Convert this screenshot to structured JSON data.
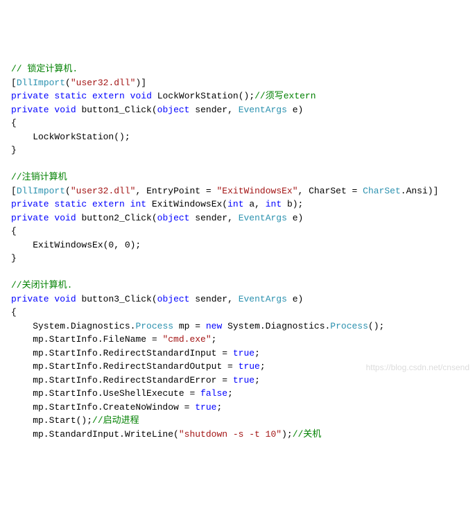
{
  "code": {
    "lines": [
      [
        {
          "cls": "c-comment",
          "t": "// 锁定计算机."
        }
      ],
      [
        {
          "cls": "c-plain",
          "t": "["
        },
        {
          "cls": "c-type",
          "t": "DllImport"
        },
        {
          "cls": "c-plain",
          "t": "("
        },
        {
          "cls": "c-string",
          "t": "\"user32.dll\""
        },
        {
          "cls": "c-plain",
          "t": ")]"
        }
      ],
      [
        {
          "cls": "c-keyword",
          "t": "private"
        },
        {
          "cls": "c-plain",
          "t": " "
        },
        {
          "cls": "c-keyword",
          "t": "static"
        },
        {
          "cls": "c-plain",
          "t": " "
        },
        {
          "cls": "c-keyword",
          "t": "extern"
        },
        {
          "cls": "c-plain",
          "t": " "
        },
        {
          "cls": "c-keyword",
          "t": "void"
        },
        {
          "cls": "c-plain",
          "t": " LockWorkStation();"
        },
        {
          "cls": "c-comment",
          "t": "//须写extern"
        }
      ],
      [
        {
          "cls": "c-keyword",
          "t": "private"
        },
        {
          "cls": "c-plain",
          "t": " "
        },
        {
          "cls": "c-keyword",
          "t": "void"
        },
        {
          "cls": "c-plain",
          "t": " button1_Click("
        },
        {
          "cls": "c-keyword",
          "t": "object"
        },
        {
          "cls": "c-plain",
          "t": " sender, "
        },
        {
          "cls": "c-type",
          "t": "EventArgs"
        },
        {
          "cls": "c-plain",
          "t": " e)"
        }
      ],
      [
        {
          "cls": "c-plain",
          "t": "{"
        }
      ],
      [
        {
          "cls": "c-plain",
          "t": "    LockWorkStation();"
        }
      ],
      [
        {
          "cls": "c-plain",
          "t": "}"
        }
      ],
      [
        {
          "cls": "c-plain",
          "t": ""
        }
      ],
      [
        {
          "cls": "c-comment",
          "t": "//注销计算机"
        }
      ],
      [
        {
          "cls": "c-plain",
          "t": "["
        },
        {
          "cls": "c-type",
          "t": "DllImport"
        },
        {
          "cls": "c-plain",
          "t": "("
        },
        {
          "cls": "c-string",
          "t": "\"user32.dll\""
        },
        {
          "cls": "c-plain",
          "t": ", EntryPoint = "
        },
        {
          "cls": "c-string",
          "t": "\"ExitWindowsEx\""
        },
        {
          "cls": "c-plain",
          "t": ", CharSet = "
        },
        {
          "cls": "c-type",
          "t": "CharSet"
        },
        {
          "cls": "c-plain",
          "t": ".Ansi)]"
        }
      ],
      [
        {
          "cls": "c-keyword",
          "t": "private"
        },
        {
          "cls": "c-plain",
          "t": " "
        },
        {
          "cls": "c-keyword",
          "t": "static"
        },
        {
          "cls": "c-plain",
          "t": " "
        },
        {
          "cls": "c-keyword",
          "t": "extern"
        },
        {
          "cls": "c-plain",
          "t": " "
        },
        {
          "cls": "c-keyword",
          "t": "int"
        },
        {
          "cls": "c-plain",
          "t": " ExitWindowsEx("
        },
        {
          "cls": "c-keyword",
          "t": "int"
        },
        {
          "cls": "c-plain",
          "t": " a, "
        },
        {
          "cls": "c-keyword",
          "t": "int"
        },
        {
          "cls": "c-plain",
          "t": " b);"
        }
      ],
      [
        {
          "cls": "c-keyword",
          "t": "private"
        },
        {
          "cls": "c-plain",
          "t": " "
        },
        {
          "cls": "c-keyword",
          "t": "void"
        },
        {
          "cls": "c-plain",
          "t": " button2_Click("
        },
        {
          "cls": "c-keyword",
          "t": "object"
        },
        {
          "cls": "c-plain",
          "t": " sender, "
        },
        {
          "cls": "c-type",
          "t": "EventArgs"
        },
        {
          "cls": "c-plain",
          "t": " e)"
        }
      ],
      [
        {
          "cls": "c-plain",
          "t": "{"
        }
      ],
      [
        {
          "cls": "c-plain",
          "t": "    ExitWindowsEx(0, 0);"
        }
      ],
      [
        {
          "cls": "c-plain",
          "t": "}"
        }
      ],
      [
        {
          "cls": "c-plain",
          "t": ""
        }
      ],
      [
        {
          "cls": "c-comment",
          "t": "//关闭计算机."
        }
      ],
      [
        {
          "cls": "c-keyword",
          "t": "private"
        },
        {
          "cls": "c-plain",
          "t": " "
        },
        {
          "cls": "c-keyword",
          "t": "void"
        },
        {
          "cls": "c-plain",
          "t": " button3_Click("
        },
        {
          "cls": "c-keyword",
          "t": "object"
        },
        {
          "cls": "c-plain",
          "t": " sender, "
        },
        {
          "cls": "c-type",
          "t": "EventArgs"
        },
        {
          "cls": "c-plain",
          "t": " e)"
        }
      ],
      [
        {
          "cls": "c-plain",
          "t": "{"
        }
      ],
      [
        {
          "cls": "c-plain",
          "t": "    System.Diagnostics."
        },
        {
          "cls": "c-type",
          "t": "Process"
        },
        {
          "cls": "c-plain",
          "t": " mp = "
        },
        {
          "cls": "c-keyword",
          "t": "new"
        },
        {
          "cls": "c-plain",
          "t": " System.Diagnostics."
        },
        {
          "cls": "c-type",
          "t": "Process"
        },
        {
          "cls": "c-plain",
          "t": "();"
        }
      ],
      [
        {
          "cls": "c-plain",
          "t": "    mp.StartInfo.FileName = "
        },
        {
          "cls": "c-string",
          "t": "\"cmd.exe\""
        },
        {
          "cls": "c-plain",
          "t": ";"
        }
      ],
      [
        {
          "cls": "c-plain",
          "t": "    mp.StartInfo.RedirectStandardInput = "
        },
        {
          "cls": "c-keyword",
          "t": "true"
        },
        {
          "cls": "c-plain",
          "t": ";"
        }
      ],
      [
        {
          "cls": "c-plain",
          "t": "    mp.StartInfo.RedirectStandardOutput = "
        },
        {
          "cls": "c-keyword",
          "t": "true"
        },
        {
          "cls": "c-plain",
          "t": ";"
        }
      ],
      [
        {
          "cls": "c-plain",
          "t": "    mp.StartInfo.RedirectStandardError = "
        },
        {
          "cls": "c-keyword",
          "t": "true"
        },
        {
          "cls": "c-plain",
          "t": ";"
        }
      ],
      [
        {
          "cls": "c-plain",
          "t": "    mp.StartInfo.UseShellExecute = "
        },
        {
          "cls": "c-keyword",
          "t": "false"
        },
        {
          "cls": "c-plain",
          "t": ";"
        }
      ],
      [
        {
          "cls": "c-plain",
          "t": "    mp.StartInfo.CreateNoWindow = "
        },
        {
          "cls": "c-keyword",
          "t": "true"
        },
        {
          "cls": "c-plain",
          "t": ";"
        }
      ],
      [
        {
          "cls": "c-plain",
          "t": "    mp.Start();"
        },
        {
          "cls": "c-comment",
          "t": "//启动进程"
        }
      ],
      [
        {
          "cls": "c-plain",
          "t": "    mp.StandardInput.WriteLine("
        },
        {
          "cls": "c-string",
          "t": "\"shutdown -s -t 10\""
        },
        {
          "cls": "c-plain",
          "t": ");"
        },
        {
          "cls": "c-comment",
          "t": "//关机"
        }
      ]
    ]
  },
  "watermark": "https://blog.csdn.net/cnsend"
}
